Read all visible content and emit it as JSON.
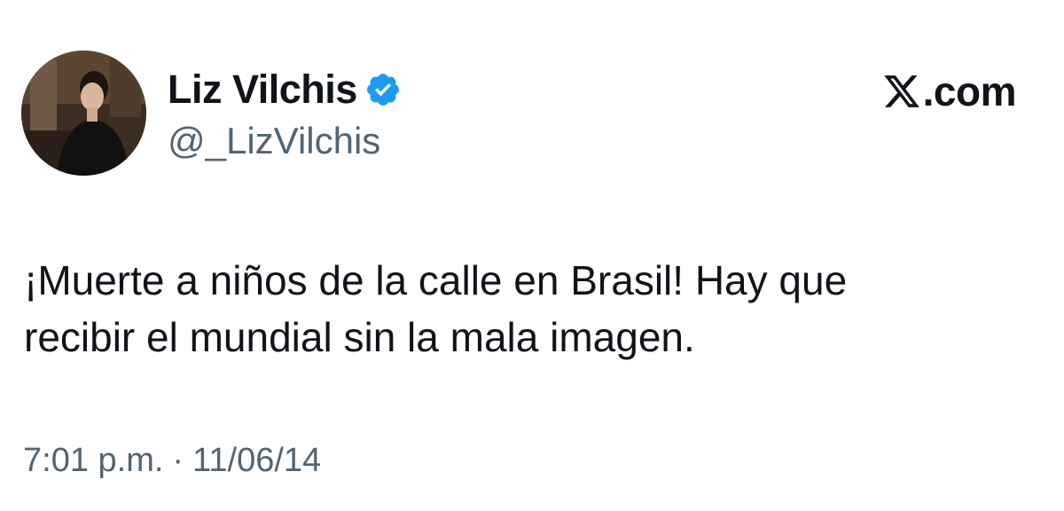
{
  "author": {
    "display_name": "Liz Vilchis",
    "handle": "@_LizVilchis",
    "verified": true,
    "avatar_icon": "profile-photo"
  },
  "brand": {
    "logo_icon": "x-logo-icon",
    "domain_text": ".com"
  },
  "tweet": {
    "text": "¡Muerte a niños de la calle en Brasil! Hay que\nrecibir el mundial sin la mala imagen."
  },
  "meta": {
    "time": "7:01 p.m.",
    "separator": "·",
    "date": "11/06/14"
  },
  "colors": {
    "verified_blue": "#1d9bf0",
    "text_primary": "#0f1419",
    "text_secondary": "#536471"
  }
}
